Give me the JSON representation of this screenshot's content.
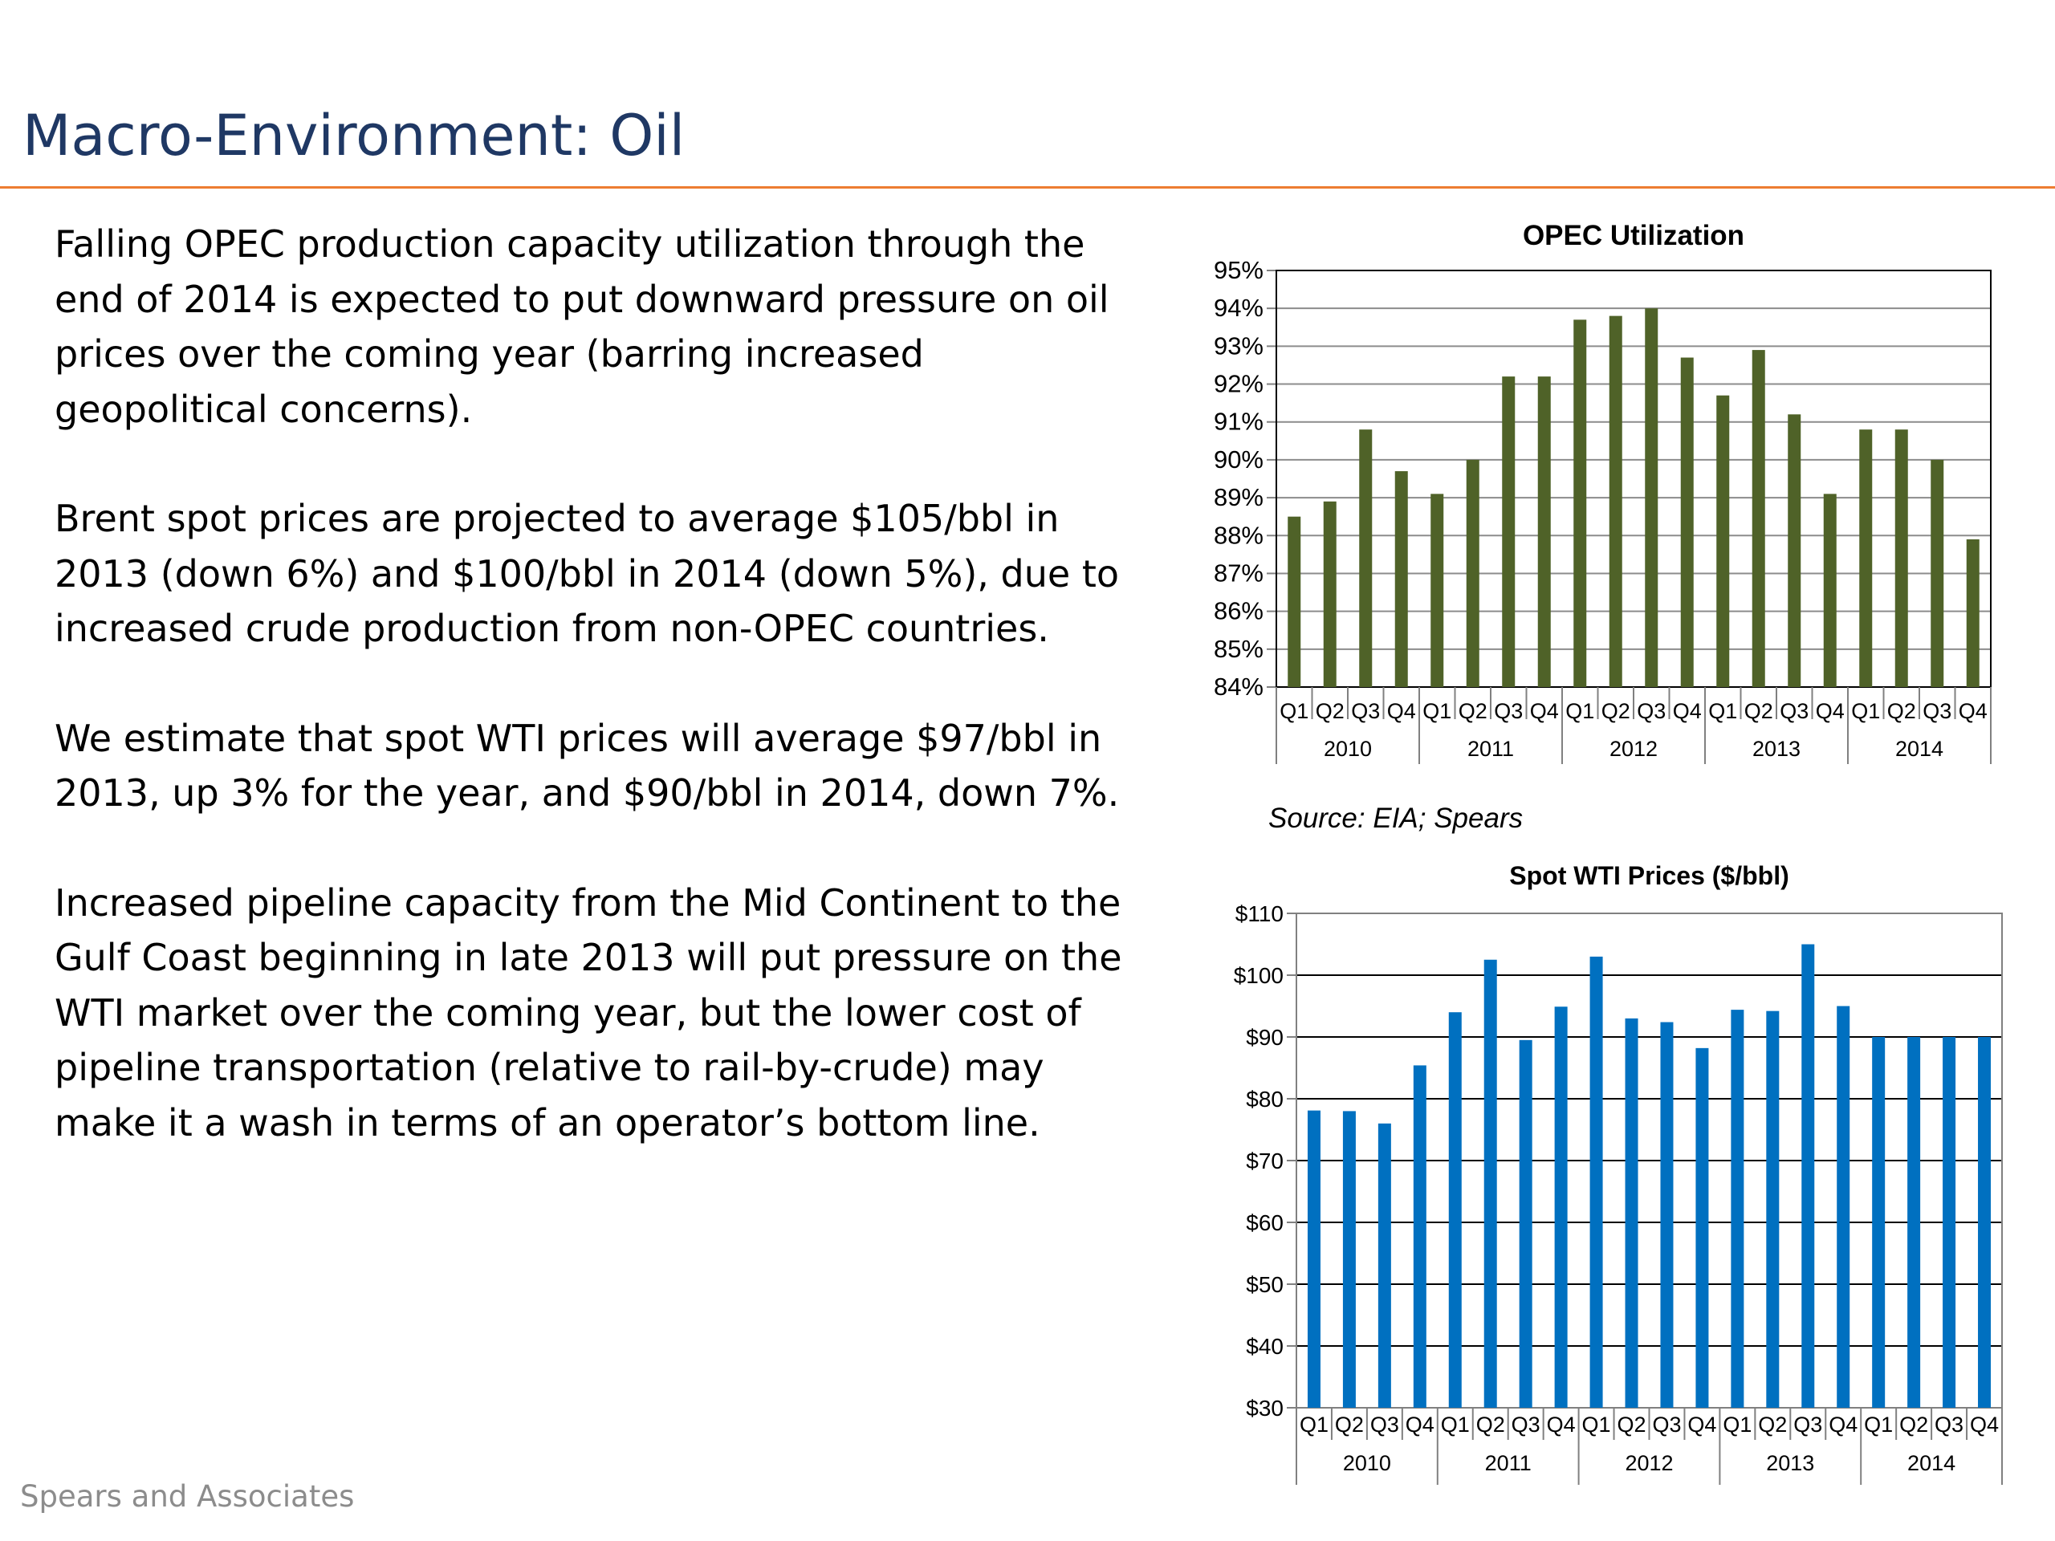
{
  "slide": {
    "title": "Macro-Environment: Oil",
    "paragraphs": [
      "Falling OPEC production capacity utilization through the end of 2014 is expected to put downward pressure on oil prices over the coming year (barring increased geopolitical concerns).",
      "Brent spot prices are projected to average $105/bbl in 2013 (down 6%) and $100/bbl in 2014 (down 5%), due to increased crude production from non-OPEC countries.",
      "We estimate that spot WTI prices will average $97/bbl in 2013, up 3% for the year, and $90/bbl in 2014, down 7%.",
      "Increased pipeline capacity from the Mid Continent to the Gulf Coast beginning in late 2013 will put pressure on the WTI market over the coming year, but the lower cost of pipeline transportation (relative to rail-by-crude) may make it a wash in terms of an operator’s bottom line."
    ],
    "source_note": "Source: EIA; Spears",
    "footer": "Spears and Associates"
  },
  "colors": {
    "title": "#1f3864",
    "rule": "#ed7d31",
    "opec_bars": "#4f6228",
    "wti_bars": "#0070c0",
    "footer": "#8c8c8c"
  },
  "chart_data": [
    {
      "type": "bar",
      "title": "OPEC Utilization",
      "categories": [
        "Q1",
        "Q2",
        "Q3",
        "Q4",
        "Q1",
        "Q2",
        "Q3",
        "Q4",
        "Q1",
        "Q2",
        "Q3",
        "Q4",
        "Q1",
        "Q2",
        "Q3",
        "Q4",
        "Q1",
        "Q2",
        "Q3",
        "Q4"
      ],
      "groups": [
        "2010",
        "2011",
        "2012",
        "2013",
        "2014"
      ],
      "values": [
        88.5,
        88.9,
        90.8,
        89.7,
        89.1,
        90.0,
        92.2,
        92.2,
        93.7,
        93.8,
        94.0,
        92.7,
        91.7,
        92.9,
        91.2,
        89.1,
        90.8,
        90.8,
        90.0,
        87.9
      ],
      "ylim": [
        84,
        95
      ],
      "ytick_labels": [
        "84%",
        "85%",
        "86%",
        "87%",
        "88%",
        "89%",
        "90%",
        "91%",
        "92%",
        "93%",
        "94%",
        "95%"
      ],
      "grid": true,
      "xlabel": "",
      "ylabel": ""
    },
    {
      "type": "bar",
      "title": "Spot WTI Prices ($/bbl)",
      "categories": [
        "Q1",
        "Q2",
        "Q3",
        "Q4",
        "Q1",
        "Q2",
        "Q3",
        "Q4",
        "Q1",
        "Q2",
        "Q3",
        "Q4",
        "Q1",
        "Q2",
        "Q3",
        "Q4",
        "Q1",
        "Q2",
        "Q3",
        "Q4"
      ],
      "groups": [
        "2010",
        "2011",
        "2012",
        "2013",
        "2014"
      ],
      "values": [
        78.1,
        78.0,
        76.0,
        85.4,
        94.0,
        102.5,
        89.5,
        94.9,
        103.0,
        93.0,
        92.4,
        88.2,
        94.4,
        94.2,
        105.0,
        95.0,
        90.0,
        90.0,
        90.0,
        90.0
      ],
      "ylim": [
        30,
        110
      ],
      "ytick_labels": [
        "$30",
        "$40",
        "$50",
        "$60",
        "$70",
        "$80",
        "$90",
        "$100",
        "$110"
      ],
      "grid": true,
      "xlabel": "",
      "ylabel": ""
    }
  ]
}
